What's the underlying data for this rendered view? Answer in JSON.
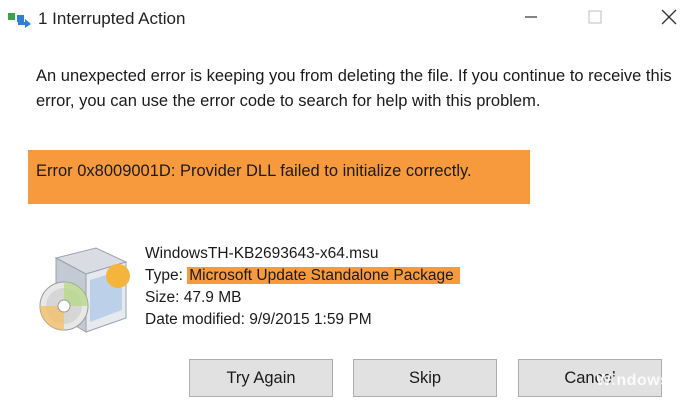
{
  "window": {
    "title": "1 Interrupted Action",
    "icon": "file-operation-icon"
  },
  "controls": {
    "minimize_icon": "minimize-icon",
    "maximize_icon": "maximize-icon",
    "close_icon": "close-icon"
  },
  "message": "An unexpected error is keeping you from deleting the file. If you continue to receive this error, you can use the error code to search for help with this problem.",
  "error": {
    "text": "Error 0x8009001D: Provider DLL failed to initialize correctly.",
    "highlight_color": "#f79a3e"
  },
  "file": {
    "icon": "installer-package-icon",
    "name": "WindowsTH-KB2693643-x64.msu",
    "type_label": "Type: ",
    "type_value": "Microsoft Update Standalone Package",
    "size": "Size: 47.9 MB",
    "date_modified": "Date modified: 9/9/2015 1:59 PM"
  },
  "buttons": {
    "try_again": "Try Again",
    "skip": "Skip",
    "cancel": "Cancel"
  },
  "watermark": "Windows"
}
